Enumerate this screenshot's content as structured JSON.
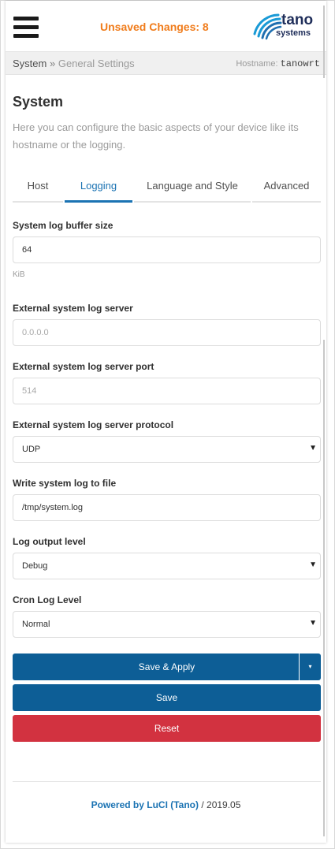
{
  "header": {
    "unsaved_changes": "Unsaved Changes: 8",
    "logo_line1": "tano",
    "logo_line2": "systems",
    "menu_icon": "hamburger-icon",
    "accent_color": "#f07c1b"
  },
  "breadcrumb": {
    "root": "System",
    "separator": "»",
    "current": "General Settings",
    "hostname_label": "Hostname:",
    "hostname_value": "tanowrt"
  },
  "main": {
    "title": "System",
    "description": "Here you can configure the basic aspects of your device like its hostname or the logging.",
    "tabs": [
      {
        "label": "Host",
        "active": false
      },
      {
        "label": "Logging",
        "active": true
      },
      {
        "label": "Language and Style",
        "active": false
      },
      {
        "label": "Advanced",
        "active": false
      }
    ],
    "fields": {
      "log_buffer_size": {
        "label": "System log buffer size",
        "value": "64",
        "hint": "KiB"
      },
      "log_server": {
        "label": "External system log server",
        "placeholder": "0.0.0.0"
      },
      "log_server_port": {
        "label": "External system log server port",
        "placeholder": "514"
      },
      "log_server_protocol": {
        "label": "External system log server protocol",
        "value": "UDP"
      },
      "log_file": {
        "label": "Write system log to file",
        "value": "/tmp/system.log"
      },
      "log_output_level": {
        "label": "Log output level",
        "value": "Debug"
      },
      "cron_log_level": {
        "label": "Cron Log Level",
        "value": "Normal"
      }
    },
    "buttons": {
      "save_apply": "Save & Apply",
      "save": "Save",
      "reset": "Reset",
      "split_arrow": "▾"
    }
  },
  "footer": {
    "powered_by": "Powered by LuCI (Tano)",
    "separator": " / ",
    "version": "2019.05"
  },
  "colors": {
    "primary": "#0d5e96",
    "danger": "#d23240",
    "link": "#1b73b3"
  }
}
